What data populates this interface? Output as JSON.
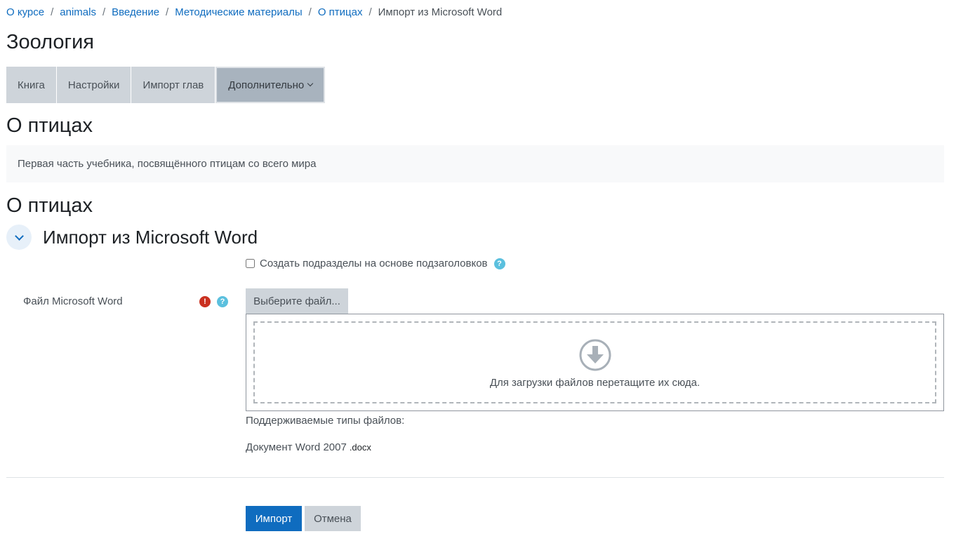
{
  "breadcrumb": {
    "items": [
      "О курсе",
      "animals",
      "Введение",
      "Методические материалы",
      "О птицах"
    ],
    "separator": "/",
    "current": "Импорт из Microsoft Word"
  },
  "course": {
    "title": "Зоология"
  },
  "tabs": {
    "items": [
      "Книга",
      "Настройки",
      "Импорт глав"
    ],
    "more_label": "Дополнительно"
  },
  "chapter": {
    "title": "О птицах",
    "intro": "Первая часть учебника, посвящённого птицам со всего мира",
    "title_repeat": "О птицах"
  },
  "section": {
    "title": "Импорт из Microsoft Word"
  },
  "form": {
    "subchapters_label": "Создать подразделы на основе подзаголовков",
    "file_label": "Файл Microsoft Word",
    "choose_file_label": "Выберите файл...",
    "dropzone_text": "Для загрузки файлов перетащите их сюда.",
    "accepted_types_label": "Поддерживаемые типы файлов:",
    "accepted_type_name": "Документ Word 2007",
    "accepted_type_ext": ".docx",
    "import_label": "Импорт",
    "cancel_label": "Отмена"
  },
  "icons": {
    "help": "?",
    "required": "!"
  },
  "colors": {
    "primary": "#0f6cbf",
    "secondary": "#ced4da",
    "help": "#5bc0de",
    "required": "#ca3120"
  }
}
